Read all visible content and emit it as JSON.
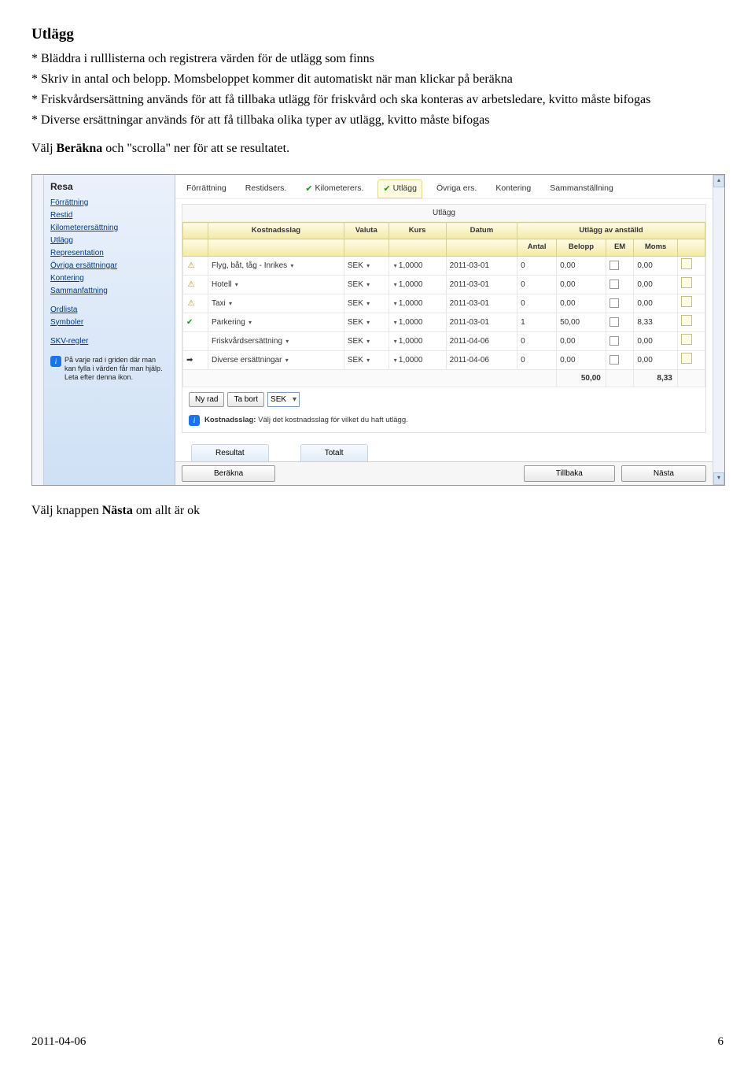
{
  "page": {
    "heading": "Utlägg",
    "bullets": [
      "* Bläddra i rulllisterna och registrera värden för de utlägg som finns",
      "* Skriv in antal och belopp. Momsbeloppet kommer dit automatiskt när man klickar på beräkna",
      "* Friskvårdsersättning används för att få tillbaka utlägg för friskvård och ska konteras av arbetsledare, kvitto måste bifogas",
      "* Diverse ersättningar används för att få tillbaka olika typer av utlägg, kvitto måste bifogas"
    ],
    "instruction1_a": "Välj ",
    "instruction1_b": "Beräkna",
    "instruction1_c": " och \"scrolla\" ner för att se resultatet.",
    "instruction2_a": "Välj knappen ",
    "instruction2_b": "Nästa",
    "instruction2_c": " om allt är ok"
  },
  "app": {
    "sidebar": {
      "title": "Resa",
      "links1": [
        "Förrättning",
        "Restid",
        "Kilometerersättning",
        "Utlägg",
        "Representation",
        "Övriga ersättningar",
        "Kontering",
        "Sammanfattning"
      ],
      "links2": [
        "Ordlista",
        "Symboler"
      ],
      "links3": [
        "SKV-regler"
      ],
      "info": "På varje rad i griden där man kan fylla i värden får man hjälp. Leta efter denna ikon."
    },
    "tabs": [
      "Förrättning",
      "Restidsers.",
      "Kilometerers.",
      "Utlägg",
      "Övriga ers.",
      "Kontering",
      "Sammanställning"
    ],
    "panel_title": "Utlägg",
    "headers": {
      "super": "Utlägg av anställd",
      "cols": [
        "",
        "Kostnadsslag",
        "Valuta",
        "Kurs",
        "Datum",
        "Antal",
        "Belopp",
        "EM",
        "Moms",
        ""
      ]
    },
    "rows": [
      {
        "icon": "warn",
        "slag": "Flyg, båt, tåg - Inrikes",
        "val": "SEK",
        "kurs": "1,0000",
        "datum": "2011-03-01",
        "antal": "0",
        "belopp": "0,00",
        "moms": "0,00"
      },
      {
        "icon": "warn",
        "slag": "Hotell",
        "val": "SEK",
        "kurs": "1,0000",
        "datum": "2011-03-01",
        "antal": "0",
        "belopp": "0,00",
        "moms": "0,00"
      },
      {
        "icon": "warn",
        "slag": "Taxi",
        "val": "SEK",
        "kurs": "1,0000",
        "datum": "2011-03-01",
        "antal": "0",
        "belopp": "0,00",
        "moms": "0,00"
      },
      {
        "icon": "ok",
        "slag": "Parkering",
        "val": "SEK",
        "kurs": "1,0000",
        "datum": "2011-03-01",
        "antal": "1",
        "belopp": "50,00",
        "moms": "8,33"
      },
      {
        "icon": "",
        "slag": "Friskvårdsersättning",
        "val": "SEK",
        "kurs": "1,0000",
        "datum": "2011-04-06",
        "antal": "0",
        "belopp": "0,00",
        "moms": "0,00"
      },
      {
        "icon": "arrow",
        "slag": "Diverse ersättningar",
        "val": "SEK",
        "kurs": "1,0000",
        "datum": "2011-04-06",
        "antal": "0",
        "belopp": "0,00",
        "moms": "0,00"
      }
    ],
    "totals": {
      "belopp": "50,00",
      "moms": "8,33"
    },
    "actions": {
      "ny": "Ny rad",
      "ta_bort": "Ta bort",
      "sek": "SEK"
    },
    "hint_label": "Kostnadsslag:",
    "hint_text": " Välj det kostnadsslag för vilket du haft utlägg.",
    "lower_tabs": [
      "Resultat",
      "Totalt"
    ],
    "bottom": {
      "berakna": "Beräkna",
      "tillbaka": "Tillbaka",
      "nasta": "Nästa"
    }
  },
  "footer": {
    "date": "2011-04-06",
    "page": "6"
  }
}
